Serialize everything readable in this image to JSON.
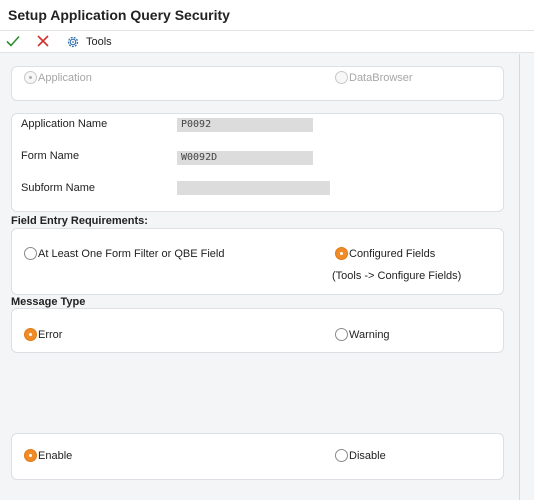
{
  "window": {
    "title": "Setup Application Query Security"
  },
  "toolbar": {
    "ok_icon": "checkmark-icon",
    "cancel_icon": "x-icon",
    "tools_icon": "gear-icon",
    "tools_label": "Tools"
  },
  "query_target": {
    "application_label": "Application",
    "databrowser_label": "DataBrowser",
    "selected": "Application"
  },
  "form": {
    "application_name_label": "Application Name",
    "application_name_value": "P0092",
    "form_name_label": "Form Name",
    "form_name_value": "W0092D",
    "subform_name_label": "Subform Name",
    "subform_name_value": ""
  },
  "field_entry": {
    "title": "Field Entry Requirements:",
    "option_at_least_one": "At Least One Form Filter or QBE Field",
    "option_configured": "Configured Fields",
    "configured_note": "(Tools -> Configure Fields)",
    "selected": "Configured Fields"
  },
  "message_type": {
    "title": "Message Type",
    "option_error": "Error",
    "option_warning": "Warning",
    "selected": "Error"
  },
  "enable": {
    "option_enable": "Enable",
    "option_disable": "Disable",
    "selected": "Enable"
  },
  "colors": {
    "accent": "#f08c28",
    "ok": "#2e8b2e",
    "cancel": "#d0322d",
    "tools": "#2f6fad"
  }
}
